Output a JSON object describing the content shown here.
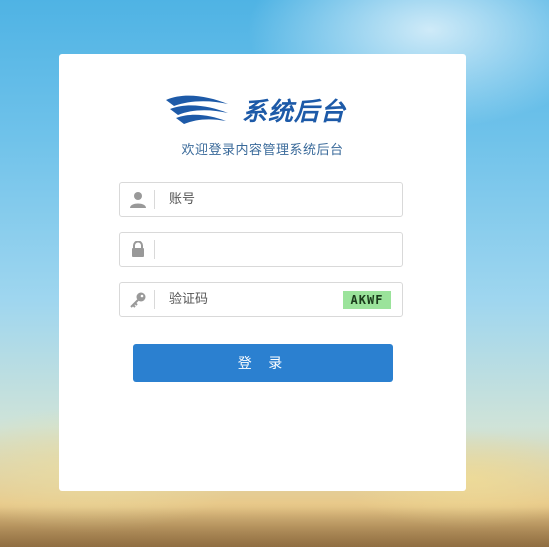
{
  "logo": {
    "text": "系统后台"
  },
  "subtitle": "欢迎登录内容管理系统后台",
  "form": {
    "account": {
      "placeholder": "账号",
      "value": "",
      "icon": "user-icon"
    },
    "password": {
      "placeholder": "",
      "value": "",
      "icon": "lock-icon"
    },
    "captcha": {
      "placeholder": "验证码",
      "value": "",
      "icon": "key-icon",
      "image_text": "AKWF"
    },
    "submit_label": "登 录"
  },
  "colors": {
    "brand": "#1d5aa8",
    "button": "#2b80d0",
    "captcha_bg": "#9be39b"
  }
}
